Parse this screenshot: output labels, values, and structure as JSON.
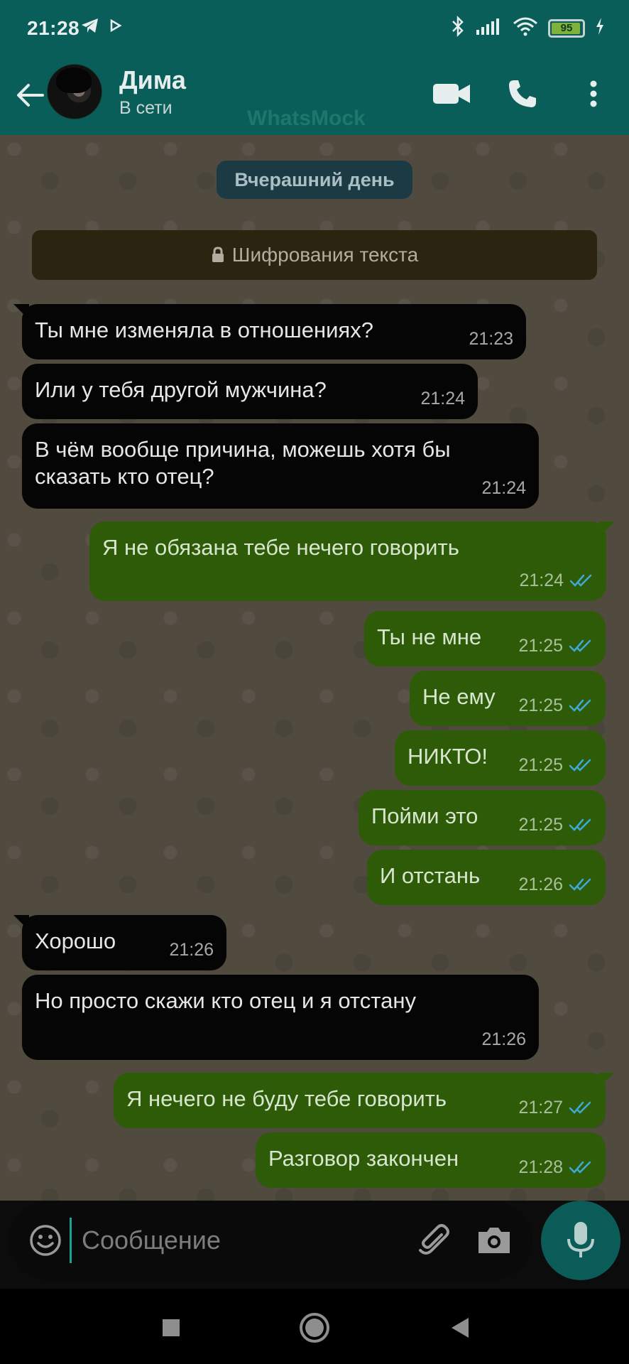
{
  "status_bar": {
    "time": "21:28",
    "battery": "95"
  },
  "header": {
    "contact_name": "Дима",
    "contact_status": "В сети",
    "watermark": "WhatsMock"
  },
  "chat": {
    "date_chip": "Вчерашний день",
    "encryption_notice": "Шифрования текста",
    "messages": [
      {
        "dir": "in",
        "text": "Ты мне изменяла в отношениях?",
        "time": "21:23"
      },
      {
        "dir": "in",
        "text": "Или у тебя другой  мужчина?",
        "time": "21:24"
      },
      {
        "dir": "in",
        "text": "В чём вообще причина, можешь хотя бы\nсказать кто отец?",
        "time": "21:24"
      },
      {
        "dir": "out",
        "text": "Я не обязана тебе нечего говорить",
        "time": "21:24"
      },
      {
        "dir": "out",
        "text": "Ты не мне",
        "time": "21:25"
      },
      {
        "dir": "out",
        "text": "Не ему",
        "time": "21:25"
      },
      {
        "dir": "out",
        "text": "НИКТО!",
        "time": "21:25"
      },
      {
        "dir": "out",
        "text": "Пойми это",
        "time": "21:25"
      },
      {
        "dir": "out",
        "text": "И отстань",
        "time": "21:26"
      },
      {
        "dir": "in",
        "text": "Хорошо",
        "time": "21:26"
      },
      {
        "dir": "in",
        "text": "Но просто скажи кто отец  и я отстану",
        "time": "21:26"
      },
      {
        "dir": "out",
        "text": "Я нечего не буду тебе говорить",
        "time": "21:27"
      },
      {
        "dir": "out",
        "text": "Разговор закончен",
        "time": "21:28"
      }
    ]
  },
  "input": {
    "placeholder": "Сообщение"
  },
  "colors": {
    "header_bg": "#0a5e59",
    "incoming_bubble": "#050505",
    "outgoing_bubble": "#2e5b07",
    "read_ticks": "#3fa9d6",
    "mic_button": "#0b5c58"
  },
  "icons": {
    "status_left": [
      "telegram-icon",
      "play-icon"
    ],
    "status_right": [
      "bluetooth-icon",
      "signal-icon",
      "wifi-icon",
      "battery-icon",
      "charging-icon"
    ],
    "header": [
      "back-arrow-icon",
      "video-call-icon",
      "phone-icon",
      "more-vert-icon"
    ],
    "input": [
      "emoji-icon",
      "attach-icon",
      "camera-icon",
      "mic-icon"
    ],
    "nav": [
      "recents-icon",
      "home-icon",
      "back-icon"
    ]
  }
}
